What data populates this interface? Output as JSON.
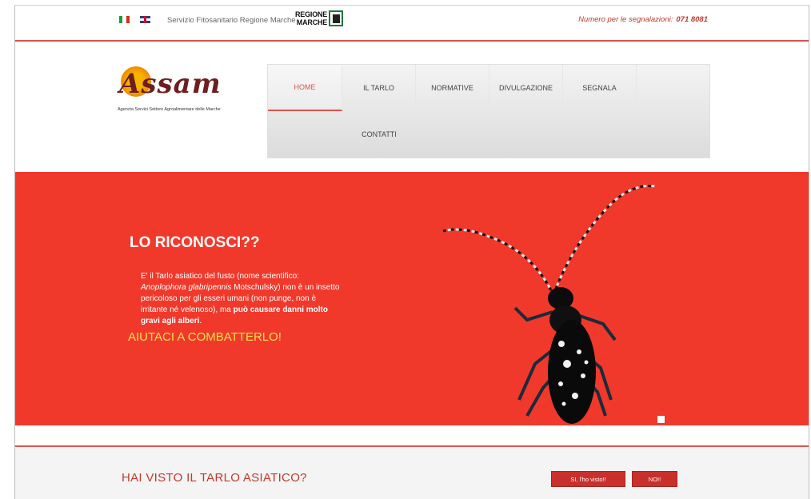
{
  "topbar": {
    "languages": [
      "it",
      "en"
    ],
    "servizio": "Servizio Fitosanitario Regione Marche",
    "regione_line1": "REGIONE",
    "regione_line2": "MARCHE",
    "numero_label": "Numero per le segnalazioni:",
    "numero_value": "071 8081"
  },
  "logo": {
    "wordmark": "Assam",
    "subtitle": "Agenzia Servizi Settore Agroalimentare delle Marche"
  },
  "nav": {
    "items": [
      {
        "label": "HOME",
        "active": true
      },
      {
        "label": "IL TARLO"
      },
      {
        "label": "NORMATIVE"
      },
      {
        "label": "DIVULGAZIONE"
      },
      {
        "label": "SEGNALA"
      },
      {
        "label": "CONTATTI"
      }
    ]
  },
  "hero": {
    "title": "LO RICONOSCI??",
    "text_1": "E' il Tarlo asiatico del fusto (nome scientifico: ",
    "text_species": "Anoplophora glabripennis",
    "text_2": " Motschulsky) non è un insetto pericoloso per gli esseri umani (non punge, non è irritante né velenoso), ma ",
    "text_bold": "può causare danni molto gravi agli alberi",
    "text_3": ".",
    "cta": "AIUTACI A COMBATTERLO!"
  },
  "bottom": {
    "question": "HAI VISTO IL TARLO ASIATICO?",
    "btn_yes": "SI, l'ho visto!!",
    "btn_no": "NO!!"
  },
  "colors": {
    "accent": "#d9534f",
    "hero_bg": "#f0392b",
    "cta": "#f4e04d",
    "button": "#c9302c"
  }
}
